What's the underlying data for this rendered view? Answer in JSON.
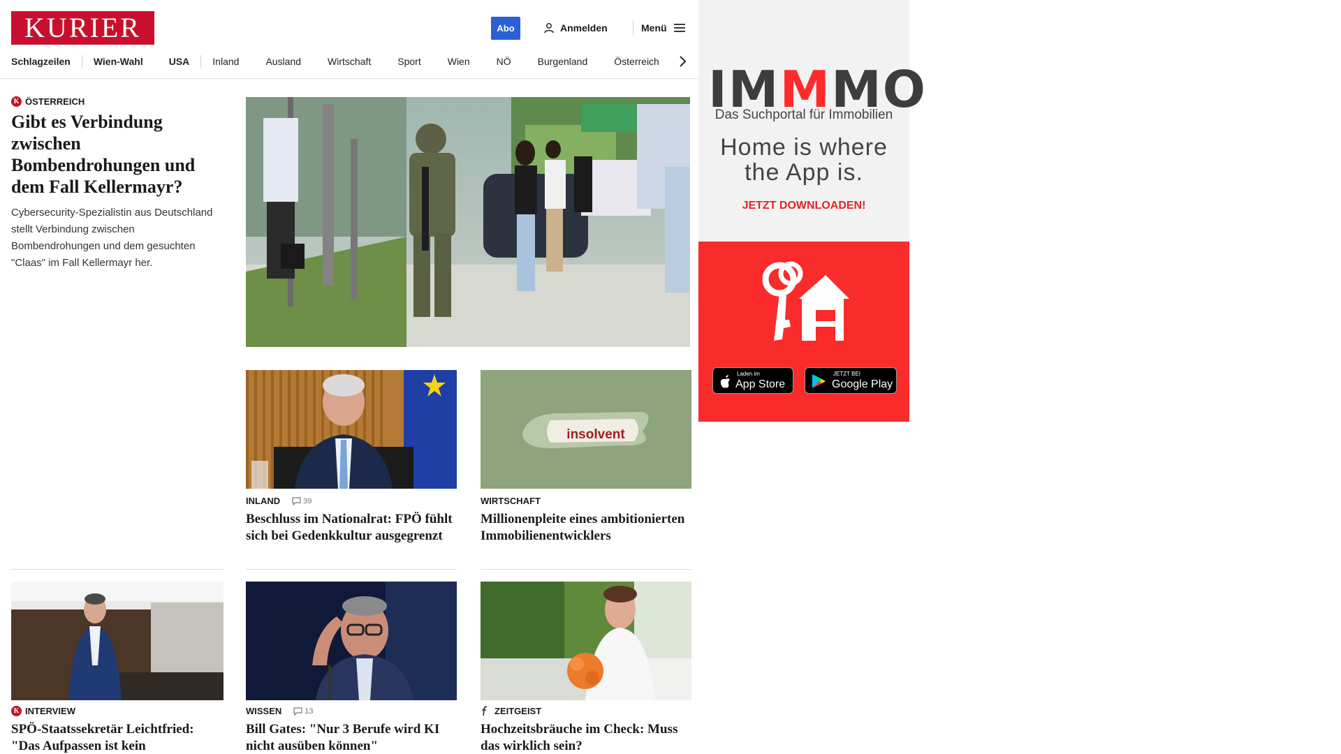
{
  "header": {
    "logo_text": "KURIER",
    "abo_label": "Abo",
    "login_label": "Anmelden",
    "menu_label": "Menü",
    "nav": [
      "Schlagzeilen",
      "Wien-Wahl",
      "USA",
      "Inland",
      "Ausland",
      "Wirtschaft",
      "Sport",
      "Wien",
      "NÖ",
      "Burgenland",
      "Österreich"
    ]
  },
  "lead": {
    "kicker": "ÖSTERREICH",
    "title": "Gibt es Verbindung zwischen Bombendrohungen und dem Fall Kellermayr?",
    "teaser": "Cybersecurity-Spezialistin aus Deutschland stellt Verbindung zwischen Bombendrohungen und dem gesuchten \"Claas\" im Fall Kellermayr her."
  },
  "cards": [
    {
      "kicker": "INLAND",
      "comments": "39",
      "title": "Beschluss im Nationalrat: FPÖ fühlt sich bei Gedenkkultur ausgegrenzt"
    },
    {
      "kicker": "WIRTSCHAFT",
      "title": "Millionenpleite eines ambitionierten Immobilienentwicklers",
      "image_text": "insolvent"
    },
    {
      "kicker": "INTERVIEW",
      "title": "SPÖ-Staatssekretär Leichtfried: \"Das Aufpassen ist kein Tätigkeitsbereich von mir\""
    },
    {
      "kicker": "WISSEN",
      "comments": "13",
      "title": "Bill Gates: \"Nur 3 Berufe wird KI nicht ausüben können\""
    },
    {
      "kicker": "ZEITGEIST",
      "title": "Hochzeitsbräuche im Check: Muss das wirklich sein?"
    }
  ],
  "ad": {
    "logo": {
      "part1": "IM",
      "part2": "M",
      "part3": "MO"
    },
    "subtitle": "Das Suchportal für Immobilien",
    "tagline_1": "Home is where",
    "tagline_2": "the App is.",
    "cta": "JETZT DOWNLOADEN!",
    "appstore_small": "Laden im",
    "appstore_big": "App Store",
    "googleplay_small": "JETZT BEI",
    "googleplay_big": "Google Play"
  },
  "colors": {
    "brand_red": "#c8102e",
    "abo_blue": "#2b5fd4",
    "ad_red": "#fa2b2b"
  }
}
